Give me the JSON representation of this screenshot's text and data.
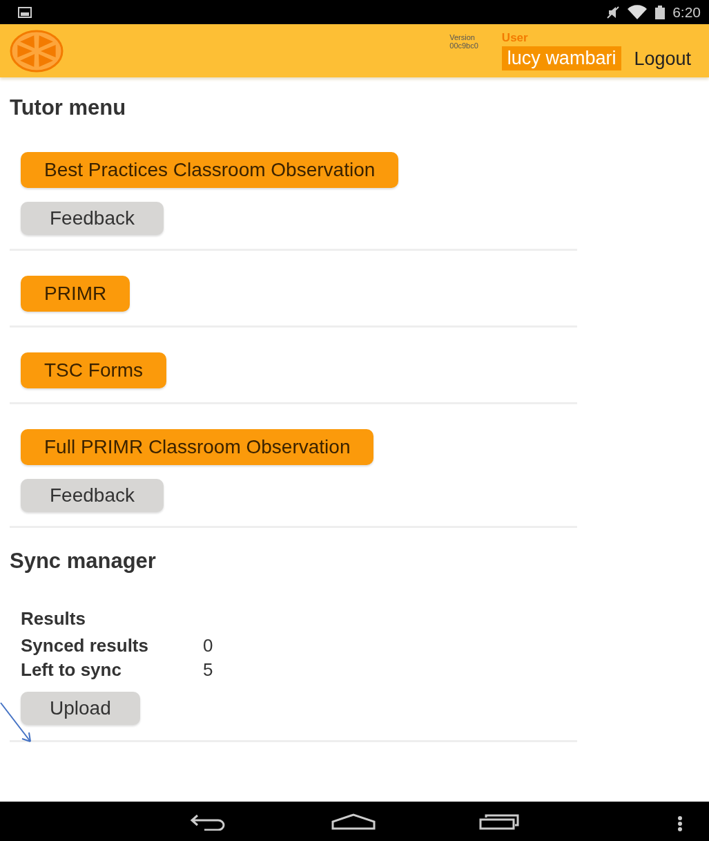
{
  "status_bar": {
    "time": "6:20"
  },
  "header": {
    "version_label": "Version",
    "version": "00c9bc0",
    "user_label": "User",
    "user_name": "lucy wambari",
    "logout": "Logout"
  },
  "tutor_menu": {
    "title": "Tutor menu",
    "items": [
      {
        "label": "Best Practices Classroom Observation",
        "feedback": "Feedback"
      },
      {
        "label": "PRIMR"
      },
      {
        "label": "TSC Forms"
      },
      {
        "label": "Full PRIMR Classroom Observation",
        "feedback": "Feedback"
      }
    ]
  },
  "sync_manager": {
    "title": "Sync manager",
    "results_title": "Results",
    "rows": [
      {
        "label": "Synced results",
        "value": "0"
      },
      {
        "label": "Left to sync",
        "value": "5"
      }
    ],
    "upload": "Upload"
  }
}
